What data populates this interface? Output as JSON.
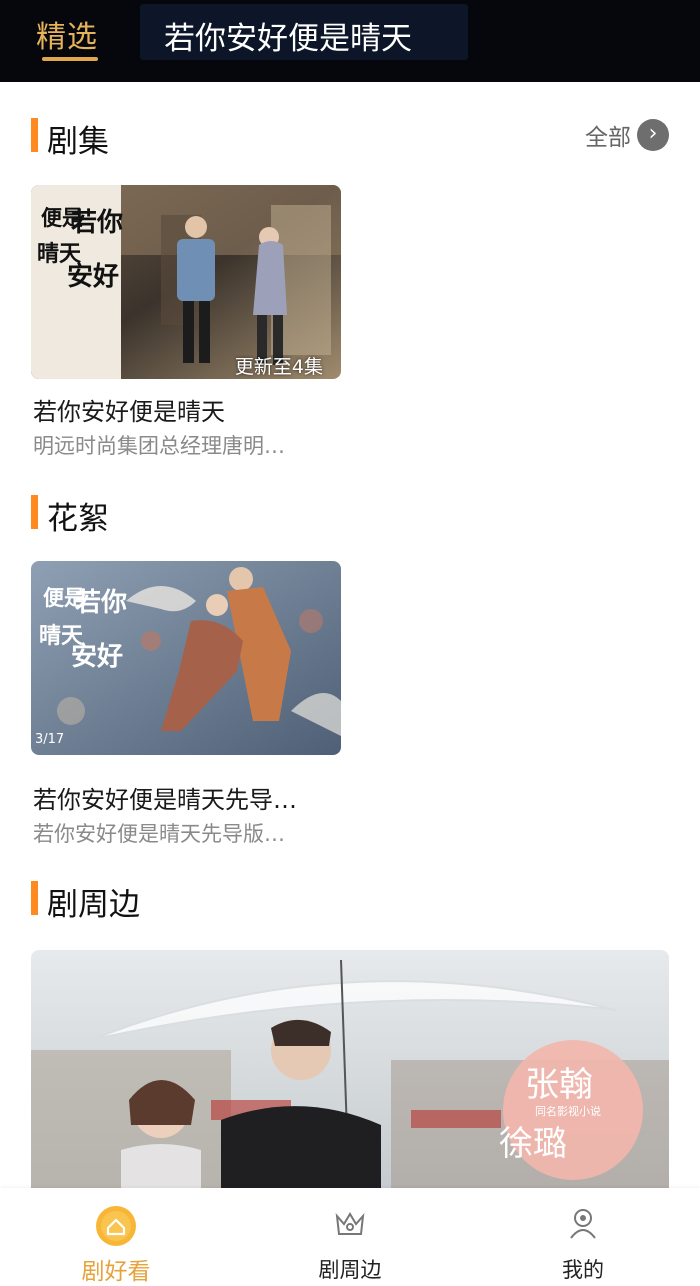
{
  "header": {
    "active_tab": "精选",
    "title": "若你安好便是晴天"
  },
  "sections": {
    "series": {
      "title": "剧集",
      "more_label": "全部",
      "card": {
        "badge": "更新至4集",
        "title": "若你安好便是晴天",
        "desc": "明远时尚集团总经理唐明…",
        "poster_text": [
          "便是",
          "晴天",
          "若你",
          "安好"
        ]
      }
    },
    "extras": {
      "title": "花絮",
      "card": {
        "title": "若你安好便是晴天先导…",
        "desc": "若你安好便是晴天先导版…",
        "poster_text": [
          "便是",
          "晴天",
          "若你",
          "安好"
        ],
        "date": "3/17"
      }
    },
    "merch": {
      "title": "剧周边",
      "banner": {
        "stamp_line1": "张翰",
        "stamp_sub": "同名影视小说",
        "stamp_line2": "徐璐"
      }
    }
  },
  "bottom_nav": [
    {
      "label": "剧好看",
      "icon": "home-icon",
      "active": true
    },
    {
      "label": "剧周边",
      "icon": "crown-icon",
      "active": false
    },
    {
      "label": "我的",
      "icon": "user-icon",
      "active": false
    }
  ],
  "colors": {
    "accent": "#ff8a1f",
    "active_tab": "#e4b35a",
    "topbar": "#05070c"
  }
}
